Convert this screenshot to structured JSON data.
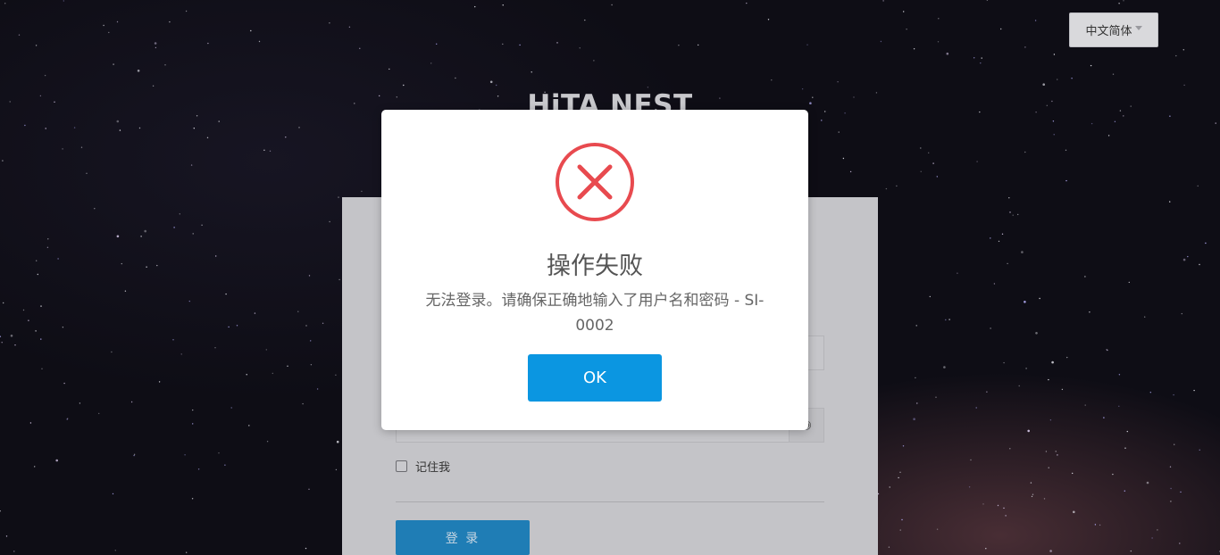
{
  "language_select": {
    "value": "中文简体"
  },
  "brand": {
    "title": "HiTA NEST"
  },
  "login": {
    "remember_label": "记住我",
    "submit_label": "登 录"
  },
  "dialog": {
    "icon": "error-x-circle-icon",
    "title": "操作失败",
    "message": "无法登录。请确保正确地输入了用户名和密码 - SI-0002",
    "ok_label": "OK"
  },
  "colors": {
    "error_red": "#e84a4f",
    "ok_button": "#0b96e1",
    "login_button": "#1f7db5"
  }
}
